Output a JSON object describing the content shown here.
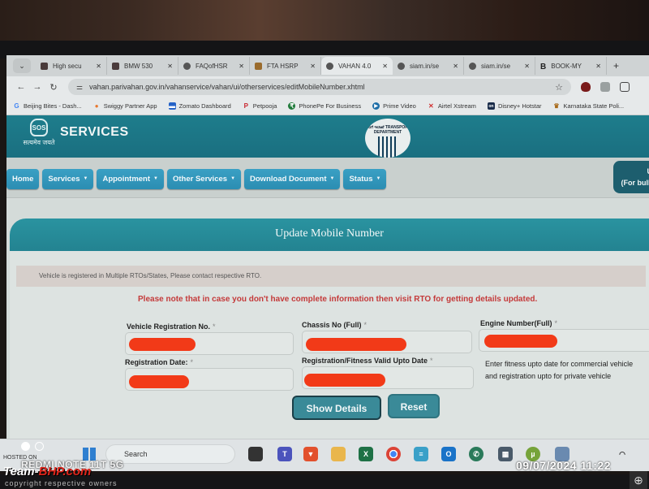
{
  "browser": {
    "tabs": [
      {
        "label": "High secu",
        "icon": "site-icon",
        "active": false
      },
      {
        "label": "BMW 530",
        "icon": "site-icon",
        "active": false
      },
      {
        "label": "FAQofHSR",
        "icon": "globe-icon",
        "active": false
      },
      {
        "label": "FTA HSRP",
        "icon": "fta-icon",
        "active": false
      },
      {
        "label": "VAHAN 4.0",
        "icon": "globe-icon",
        "active": true
      },
      {
        "label": "siam.in/se",
        "icon": "globe-icon",
        "active": false
      },
      {
        "label": "siam.in/se",
        "icon": "globe-icon",
        "active": false
      },
      {
        "label": "BOOK-MY",
        "icon": "b-icon",
        "active": false
      }
    ],
    "new_tab": "+",
    "tab_close": "✕",
    "tab_menu": "⌄",
    "url": "vahan.parivahan.gov.in/vahanservice/vahan/ui/otherservices/editMobileNumber.xhtml",
    "nav": {
      "back": "←",
      "forward": "→",
      "reload": "↻",
      "star": "☆",
      "tune": "⚌"
    },
    "bookmarks": [
      {
        "label": "Beijing Bites - Dash...",
        "icon": "G"
      },
      {
        "label": "Swiggy Partner App",
        "icon": "●"
      },
      {
        "label": "Zomato Dashboard",
        "icon": "▬"
      },
      {
        "label": "Petpooja",
        "icon": "P"
      },
      {
        "label": "PhonePe For Business",
        "icon": "₹"
      },
      {
        "label": "Prime Video",
        "icon": "▶"
      },
      {
        "label": "Airtel Xstream",
        "icon": "✕"
      },
      {
        "label": "Disney+ Hotstar",
        "icon": "on"
      },
      {
        "label": "Karnataka State Poli...",
        "icon": "♛"
      }
    ]
  },
  "site": {
    "title": "SERVICES",
    "emblem_text": "SOS",
    "motto": "सत्यमेव जयते",
    "dept_logo_text": "ಸಾರಿಗೆ ಇಲಾಖೆ TRANSPORT DEPARTMENT",
    "nav": [
      {
        "label": "Home",
        "dropdown": false
      },
      {
        "label": "Services",
        "dropdown": true
      },
      {
        "label": "Appointment",
        "dropdown": true
      },
      {
        "label": "Other Services",
        "dropdown": true
      },
      {
        "label": "Download Document",
        "dropdown": true
      },
      {
        "label": "Status",
        "dropdown": true
      }
    ],
    "caret": "▼",
    "user_box": {
      "line1": "U",
      "line2": "(For bulk"
    }
  },
  "form": {
    "heading": "Update Mobile Number",
    "alert": "Vehicle is registered in Multiple RTOs/States, Please contact respective RTO.",
    "note": "Please note that in case you don't have complete information then visit RTO for getting details updated.",
    "fields": {
      "reg_no": {
        "label": "Vehicle Registration No.",
        "required": "*",
        "value": "[redacted]"
      },
      "chassis": {
        "label": "Chassis No (Full)",
        "required": "*",
        "value": "[redacted]"
      },
      "engine": {
        "label": "Engine Number(Full)",
        "required": "*",
        "value": "[redacted]"
      },
      "reg_date": {
        "label": "Registration Date:",
        "required": "*",
        "value": "[redacted]"
      },
      "valid_upto": {
        "label": "Registration/Fitness Valid Upto Date",
        "required": "*",
        "value": "[redacted]"
      }
    },
    "helper_line1": "Enter fitness upto date for commercial vehicle",
    "helper_line2": "and registration upto for private vehicle",
    "buttons": {
      "show": "Show Details",
      "reset": "Reset"
    }
  },
  "taskbar": {
    "search_placeholder": "Search",
    "apps": [
      "File Explorer",
      "Excel",
      "Chrome",
      "Notepad",
      "Outlook (new)",
      "WhatsApp",
      "Calculator",
      "uTorrent",
      "Recycle"
    ]
  },
  "overlay": {
    "camera": "REDMI NOTE 11T 5G",
    "datetime": "09/07/2024  11:22",
    "hosted": "HOSTED ON",
    "brand_team": "Team-",
    "brand_bhp": "BHP.com",
    "copyright": "copyright respective owners",
    "zoom": "⊕"
  }
}
